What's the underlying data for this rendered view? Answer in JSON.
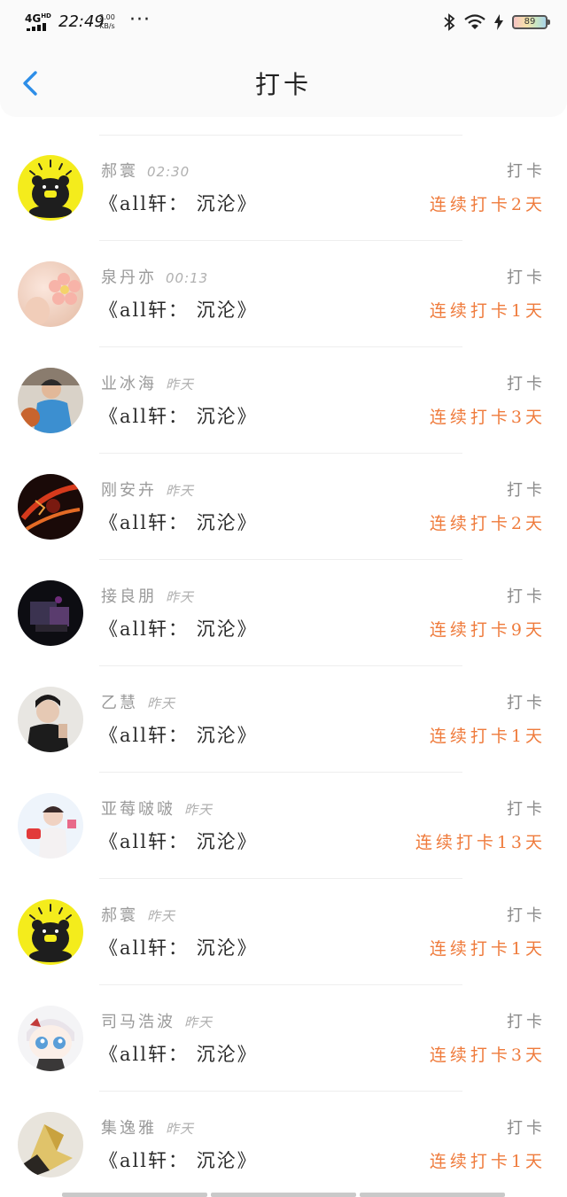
{
  "status_bar": {
    "network": "4G",
    "network_sup": "HD",
    "time": "22:49",
    "speed_value": "2.00",
    "speed_unit": "KB/s",
    "dots": "···",
    "battery": "89",
    "icons": [
      "bluetooth-icon",
      "wifi-icon",
      "charging-icon",
      "battery-icon"
    ]
  },
  "nav": {
    "back_icon": "chevron-left-icon",
    "title": "打卡"
  },
  "colors": {
    "accent_blue": "#2d8ee8",
    "streak_orange": "#ef7b3c",
    "avatar_yellow": "#f4ec1c"
  },
  "checkins": [
    {
      "name": "郝寰",
      "time": "02:30",
      "book": "《all轩： 沉沦》",
      "action": "打卡",
      "streak": "连续打卡2天",
      "avatar": "bear"
    },
    {
      "name": "泉丹亦",
      "time": "00:13",
      "book": "《all轩： 沉沦》",
      "action": "打卡",
      "streak": "连续打卡1天",
      "avatar": "peach"
    },
    {
      "name": "业冰海",
      "time": "昨天",
      "book": "《all轩： 沉沦》",
      "action": "打卡",
      "streak": "连续打卡3天",
      "avatar": "photo-blue"
    },
    {
      "name": "刚安卉",
      "time": "昨天",
      "book": "《all轩： 沉沦》",
      "action": "打卡",
      "streak": "连续打卡2天",
      "avatar": "photo-red"
    },
    {
      "name": "接良朋",
      "time": "昨天",
      "book": "《all轩： 沉沦》",
      "action": "打卡",
      "streak": "连续打卡9天",
      "avatar": "photo-dark"
    },
    {
      "name": "乙慧",
      "time": "昨天",
      "book": "《all轩： 沉沦》",
      "action": "打卡",
      "streak": "连续打卡1天",
      "avatar": "photo-gray"
    },
    {
      "name": "亚莓啵啵",
      "time": "昨天",
      "book": "《all轩： 沉沦》",
      "action": "打卡",
      "streak": "连续打卡13天",
      "avatar": "photo-pink"
    },
    {
      "name": "郝寰",
      "time": "昨天",
      "book": "《all轩： 沉沦》",
      "action": "打卡",
      "streak": "连续打卡1天",
      "avatar": "bear"
    },
    {
      "name": "司马浩波",
      "time": "昨天",
      "book": "《all轩： 沉沦》",
      "action": "打卡",
      "streak": "连续打卡3天",
      "avatar": "anime"
    },
    {
      "name": "集逸雅",
      "time": "昨天",
      "book": "《all轩： 沉沦》",
      "action": "打卡",
      "streak": "连续打卡1天",
      "avatar": "gold"
    }
  ]
}
